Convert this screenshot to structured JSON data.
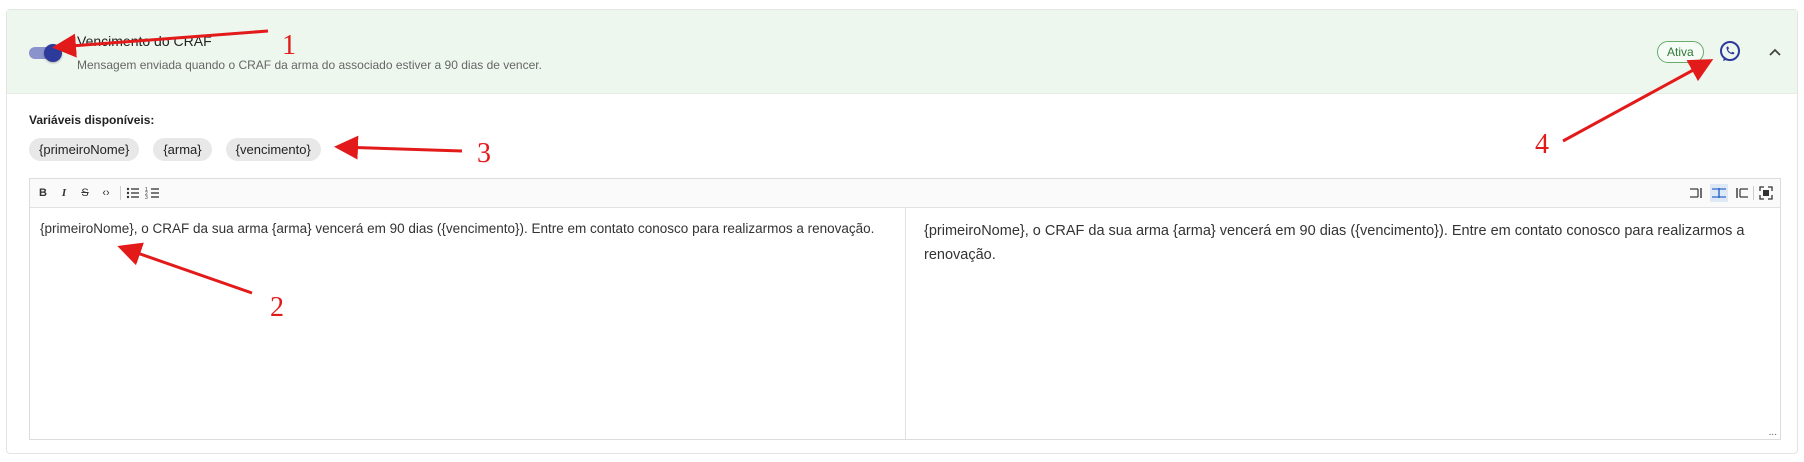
{
  "header": {
    "title": "Vencimento do CRAF",
    "subtitle": "Mensagem enviada quando o CRAF da arma do associado estiver a 90 dias de vencer.",
    "status_badge": "Ativa",
    "toggle_on": true
  },
  "variables": {
    "label": "Variáveis disponíveis:",
    "chips": [
      "{primeiroNome}",
      "{arma}",
      "{vencimento}"
    ]
  },
  "editor": {
    "toolbar_left": [
      {
        "icon": "bold-icon",
        "label": "B"
      },
      {
        "icon": "italic-icon",
        "label": "I"
      },
      {
        "icon": "strikethrough-icon",
        "label": "S"
      },
      {
        "icon": "code-icon",
        "label": "‹›"
      },
      {
        "icon": "bullet-list-icon",
        "label": ""
      },
      {
        "icon": "ordered-list-icon",
        "label": ""
      }
    ],
    "toolbar_right": [
      {
        "icon": "edit-only-icon"
      },
      {
        "icon": "split-view-icon"
      },
      {
        "icon": "preview-only-icon"
      },
      {
        "icon": "fullscreen-icon"
      }
    ],
    "source_text": "{primeiroNome}, o CRAF da sua arma {arma} vencerá em 90 dias ({vencimento}). Entre em contato conosco para realizarmos a renovação.",
    "preview_text": "{primeiroNome}, o CRAF da sua arma {arma} vencerá em 90 dias ({vencimento}). Entre em contato conosco para realizarmos a renovação.",
    "resize_handle": "..."
  },
  "annotations": [
    "1",
    "2",
    "3",
    "4"
  ],
  "colors": {
    "header_bg": "#eef7ee",
    "toggle_thumb": "#2c3a9c",
    "badge_green": "#2f7a36",
    "annotation_red": "#e31a1a"
  }
}
